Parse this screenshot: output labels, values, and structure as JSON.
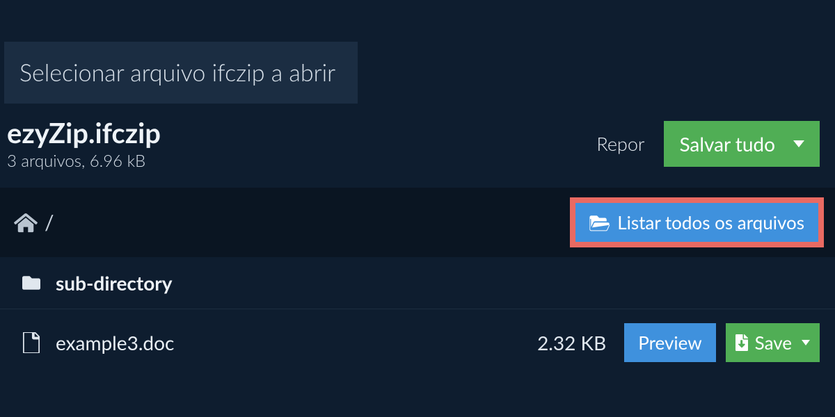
{
  "tab": {
    "label": "Selecionar arquivo ifczip a abrir"
  },
  "file": {
    "name": "ezyZip.ifczip",
    "summary": "3 arquivos, 6.96 kB"
  },
  "actions": {
    "reset": "Repor",
    "save_all": "Salvar tudo",
    "list_all": "Listar todos os arquivos",
    "preview": "Preview",
    "save": "Save"
  },
  "breadcrumb": {
    "separator": "/"
  },
  "rows": [
    {
      "type": "folder",
      "name": "sub-directory"
    },
    {
      "type": "file",
      "name": "example3.doc",
      "size": "2.32 KB"
    }
  ]
}
